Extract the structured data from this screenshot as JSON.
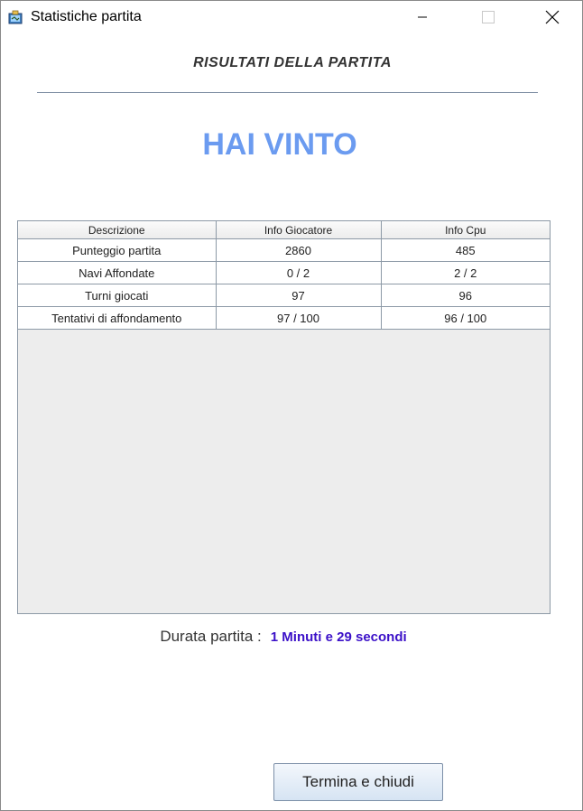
{
  "window": {
    "title": "Statistiche partita",
    "icon": "app-game-icon"
  },
  "heading": "RISULTATI DELLA PARTITA",
  "result": "HAI VINTO",
  "colors": {
    "result": "#6b9bf0",
    "duration_value": "#3b10c8",
    "rule": "#7a8aa0"
  },
  "table": {
    "headers": [
      "Descrizione",
      "Info Giocatore",
      "Info Cpu"
    ],
    "rows": [
      [
        "Punteggio partita",
        "2860",
        "485"
      ],
      [
        "Navi Affondate",
        "0 / 2",
        "2 / 2"
      ],
      [
        "Turni giocati",
        "97",
        "96"
      ],
      [
        "Tentativi di affondamento",
        "97 / 100",
        "96 / 100"
      ]
    ]
  },
  "duration": {
    "label": "Durata partita :",
    "value": "1 Minuti e 29 secondi"
  },
  "buttons": {
    "close_label": "Termina e chiudi"
  }
}
